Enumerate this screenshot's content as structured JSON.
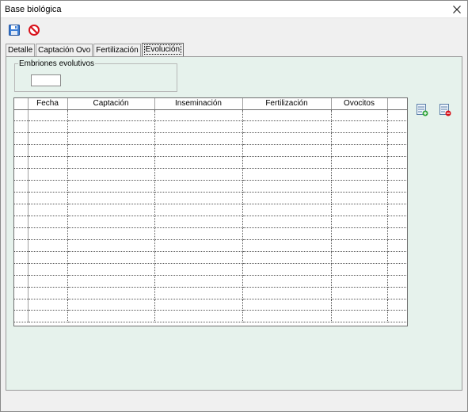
{
  "window": {
    "title": "Base biológica"
  },
  "icons": {
    "close": "close-icon",
    "save": "save-icon",
    "cancel": "cancel-icon",
    "add_row": "add-row-icon",
    "delete_row": "delete-row-icon"
  },
  "colors": {
    "panel_bg": "#e6f2ec",
    "cancel_red": "#d8121b",
    "save_blue": "#2a6fc9"
  },
  "tabs": [
    {
      "label": "Detalle"
    },
    {
      "label": "Captación Ovo"
    },
    {
      "label": "Fertilización"
    },
    {
      "label": "Evolución",
      "active": true
    }
  ],
  "embriones": {
    "legend": "Embriones evolutivos",
    "value": ""
  },
  "grid": {
    "columns": [
      "",
      "Fecha",
      "Captación",
      "Inseminación",
      "Fertilización",
      "Ovocitos",
      ""
    ],
    "row_count": 18
  }
}
